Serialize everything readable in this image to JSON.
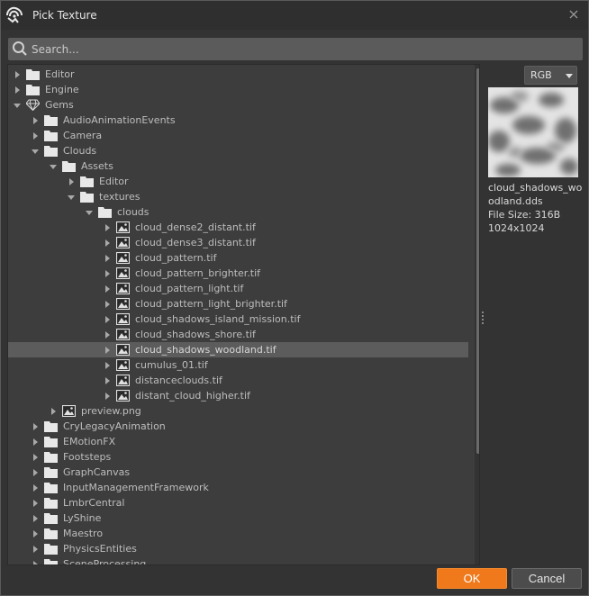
{
  "window": {
    "title": "Pick Texture"
  },
  "search": {
    "placeholder": "Search..."
  },
  "tree": [
    {
      "label": "Editor",
      "depth": 0,
      "expanded": false,
      "icon": "folder-icon"
    },
    {
      "label": "Engine",
      "depth": 0,
      "expanded": false,
      "icon": "folder-icon"
    },
    {
      "label": "Gems",
      "depth": 0,
      "expanded": true,
      "icon": "gem-icon"
    },
    {
      "label": "AudioAnimationEvents",
      "depth": 1,
      "expanded": false,
      "icon": "folder-icon"
    },
    {
      "label": "Camera",
      "depth": 1,
      "expanded": false,
      "icon": "folder-icon"
    },
    {
      "label": "Clouds",
      "depth": 1,
      "expanded": true,
      "icon": "folder-icon"
    },
    {
      "label": "Assets",
      "depth": 2,
      "expanded": true,
      "icon": "folder-icon"
    },
    {
      "label": "Editor",
      "depth": 3,
      "expanded": false,
      "icon": "folder-icon"
    },
    {
      "label": "textures",
      "depth": 3,
      "expanded": true,
      "icon": "folder-icon"
    },
    {
      "label": "clouds",
      "depth": 4,
      "expanded": true,
      "icon": "folder-icon"
    },
    {
      "label": "cloud_dense2_distant.tif",
      "depth": 5,
      "expanded": false,
      "icon": "image-icon"
    },
    {
      "label": "cloud_dense3_distant.tif",
      "depth": 5,
      "expanded": false,
      "icon": "image-icon"
    },
    {
      "label": "cloud_pattern.tif",
      "depth": 5,
      "expanded": false,
      "icon": "image-icon"
    },
    {
      "label": "cloud_pattern_brighter.tif",
      "depth": 5,
      "expanded": false,
      "icon": "image-icon"
    },
    {
      "label": "cloud_pattern_light.tif",
      "depth": 5,
      "expanded": false,
      "icon": "image-icon"
    },
    {
      "label": "cloud_pattern_light_brighter.tif",
      "depth": 5,
      "expanded": false,
      "icon": "image-icon"
    },
    {
      "label": "cloud_shadows_island_mission.tif",
      "depth": 5,
      "expanded": false,
      "icon": "image-icon"
    },
    {
      "label": "cloud_shadows_shore.tif",
      "depth": 5,
      "expanded": false,
      "icon": "image-icon"
    },
    {
      "label": "cloud_shadows_woodland.tif",
      "depth": 5,
      "expanded": false,
      "icon": "image-icon",
      "selected": true
    },
    {
      "label": "cumulus_01.tif",
      "depth": 5,
      "expanded": false,
      "icon": "image-icon"
    },
    {
      "label": "distanceclouds.tif",
      "depth": 5,
      "expanded": false,
      "icon": "image-icon"
    },
    {
      "label": "distant_cloud_higher.tif",
      "depth": 5,
      "expanded": false,
      "icon": "image-icon"
    },
    {
      "label": "preview.png",
      "depth": 2,
      "expanded": false,
      "icon": "image-icon"
    },
    {
      "label": "CryLegacyAnimation",
      "depth": 1,
      "expanded": false,
      "icon": "folder-icon"
    },
    {
      "label": "EMotionFX",
      "depth": 1,
      "expanded": false,
      "icon": "folder-icon"
    },
    {
      "label": "Footsteps",
      "depth": 1,
      "expanded": false,
      "icon": "folder-icon"
    },
    {
      "label": "GraphCanvas",
      "depth": 1,
      "expanded": false,
      "icon": "folder-icon"
    },
    {
      "label": "InputManagementFramework",
      "depth": 1,
      "expanded": false,
      "icon": "folder-icon"
    },
    {
      "label": "LmbrCentral",
      "depth": 1,
      "expanded": false,
      "icon": "folder-icon"
    },
    {
      "label": "LyShine",
      "depth": 1,
      "expanded": false,
      "icon": "folder-icon"
    },
    {
      "label": "Maestro",
      "depth": 1,
      "expanded": false,
      "icon": "folder-icon"
    },
    {
      "label": "PhysicsEntities",
      "depth": 1,
      "expanded": false,
      "icon": "folder-icon"
    },
    {
      "label": "SceneProcessing",
      "depth": 1,
      "expanded": false,
      "icon": "folder-icon"
    }
  ],
  "preview": {
    "format": "RGB",
    "file_name": "cloud_shadows_woodland.dds",
    "file_size": "File Size: 316B",
    "dimensions": "1024x1024"
  },
  "buttons": {
    "ok": "OK",
    "cancel": "Cancel"
  },
  "colors": {
    "accent": "#f0791b",
    "selection": "#5c5c5c"
  }
}
